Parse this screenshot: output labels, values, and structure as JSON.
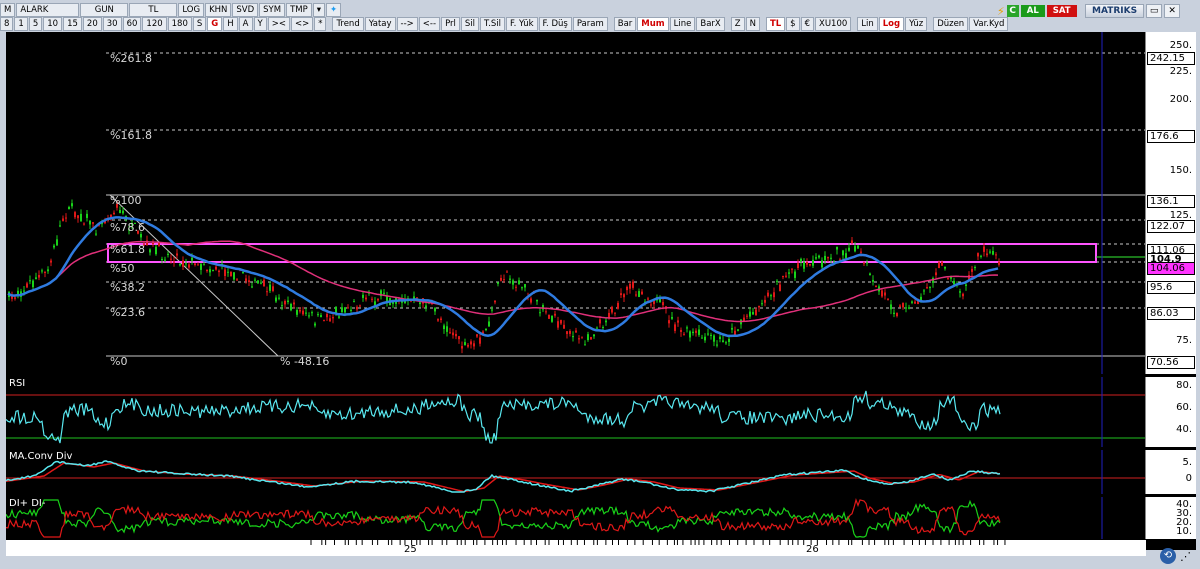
{
  "toolbar": {
    "row1": [
      "M",
      "ALARK",
      "GUN",
      "TL",
      "LOG",
      "KHN",
      "SVD",
      "SYM",
      "TMP"
    ],
    "row2": [
      "8",
      "1",
      "5",
      "10",
      "15",
      "20",
      "30",
      "60",
      "120",
      "180",
      "S",
      "G",
      "H",
      "A",
      "Y",
      "><",
      "<>",
      "*"
    ],
    "row2_selected": "G",
    "tools": [
      "Trend",
      "Yatay",
      "-->",
      "<--",
      "Prl",
      "Sil",
      "T.Sil",
      "F. Yük",
      "F. Düş",
      "Param"
    ],
    "chart_modes": [
      "Bar",
      "Mum",
      "Line",
      "BarX"
    ],
    "chart_modes_active": "Mum",
    "zoom": [
      "Z",
      "N"
    ],
    "currency": [
      "TL",
      "$",
      "€",
      "XU100"
    ],
    "currency_active": "TL",
    "scale": [
      "Lin",
      "Log",
      "Yüz"
    ],
    "scale_active": "Log",
    "edit": "Düzen",
    "vars": "Var.Kyd",
    "buy": "AL",
    "sell": "SAT",
    "brand": "MATRIKS"
  },
  "price_axis": [
    "250.",
    "225.",
    "200.",
    "150.",
    "125.",
    "75."
  ],
  "price_tags": [
    "242.15",
    "176.6",
    "136.1",
    "122.07",
    "111.06",
    "104.9",
    "104.06",
    "95.6",
    "86.03",
    "70.56"
  ],
  "fib_labels": [
    "%261.8",
    "%161.8",
    "%100",
    "%78.6",
    "%61.8",
    "%50",
    "%38.2",
    "%23.6",
    "%0"
  ],
  "trend_label": "% -48.16",
  "rsi": {
    "label": "RSI",
    "axis": [
      "80.",
      "60.",
      "40."
    ]
  },
  "macd": {
    "label": "MA.Conv Div",
    "axis": [
      "5.",
      "0"
    ]
  },
  "dmi": {
    "label": "DI+ DI-",
    "axis": [
      "40.",
      "30.",
      "20.",
      "10."
    ]
  },
  "dates": [
    "25",
    "26"
  ],
  "colors": {
    "up": "#19d219",
    "down": "#e01818",
    "ma_fast": "#2f7be0",
    "ma_slow": "#e0307a",
    "rsi": "#59e8f0",
    "fib": "#c8c8c8",
    "box": "#ff55ff"
  }
}
